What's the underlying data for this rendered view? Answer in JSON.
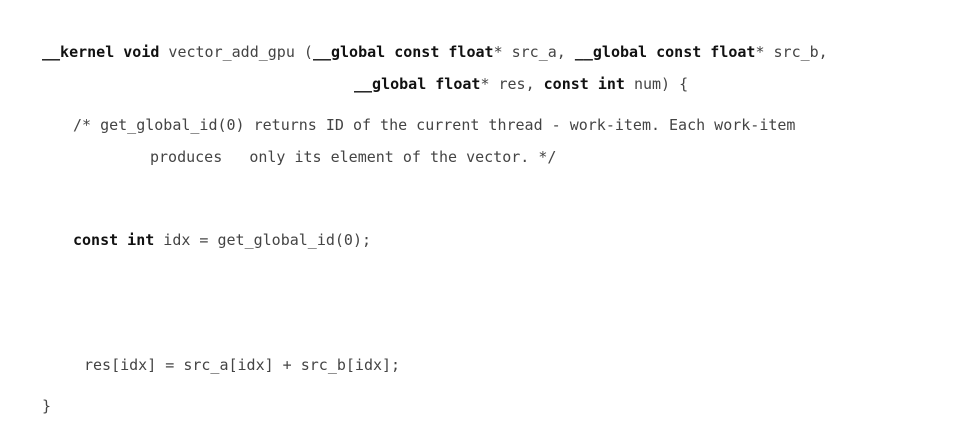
{
  "code": {
    "line1": {
      "t1": "__kernel void",
      "t2": " vector_add_gpu (",
      "t3": "__global const float",
      "t4": "* src_a, ",
      "t5": "__global const float",
      "t6": "* src_b,"
    },
    "line2": {
      "t1": "__global float",
      "t2": "* res, ",
      "t3": "const int",
      "t4": " num) {"
    },
    "line3": "/* get_global_id(0) returns ID of the current thread - work-item. Each work-item",
    "line4": "produces   only its element of the vector. */",
    "line5": {
      "t1": "const int",
      "t2": " idx = get_global_id(0);"
    },
    "line6": "res[idx] = src_a[idx] + src_b[idx];",
    "line7": "}"
  }
}
